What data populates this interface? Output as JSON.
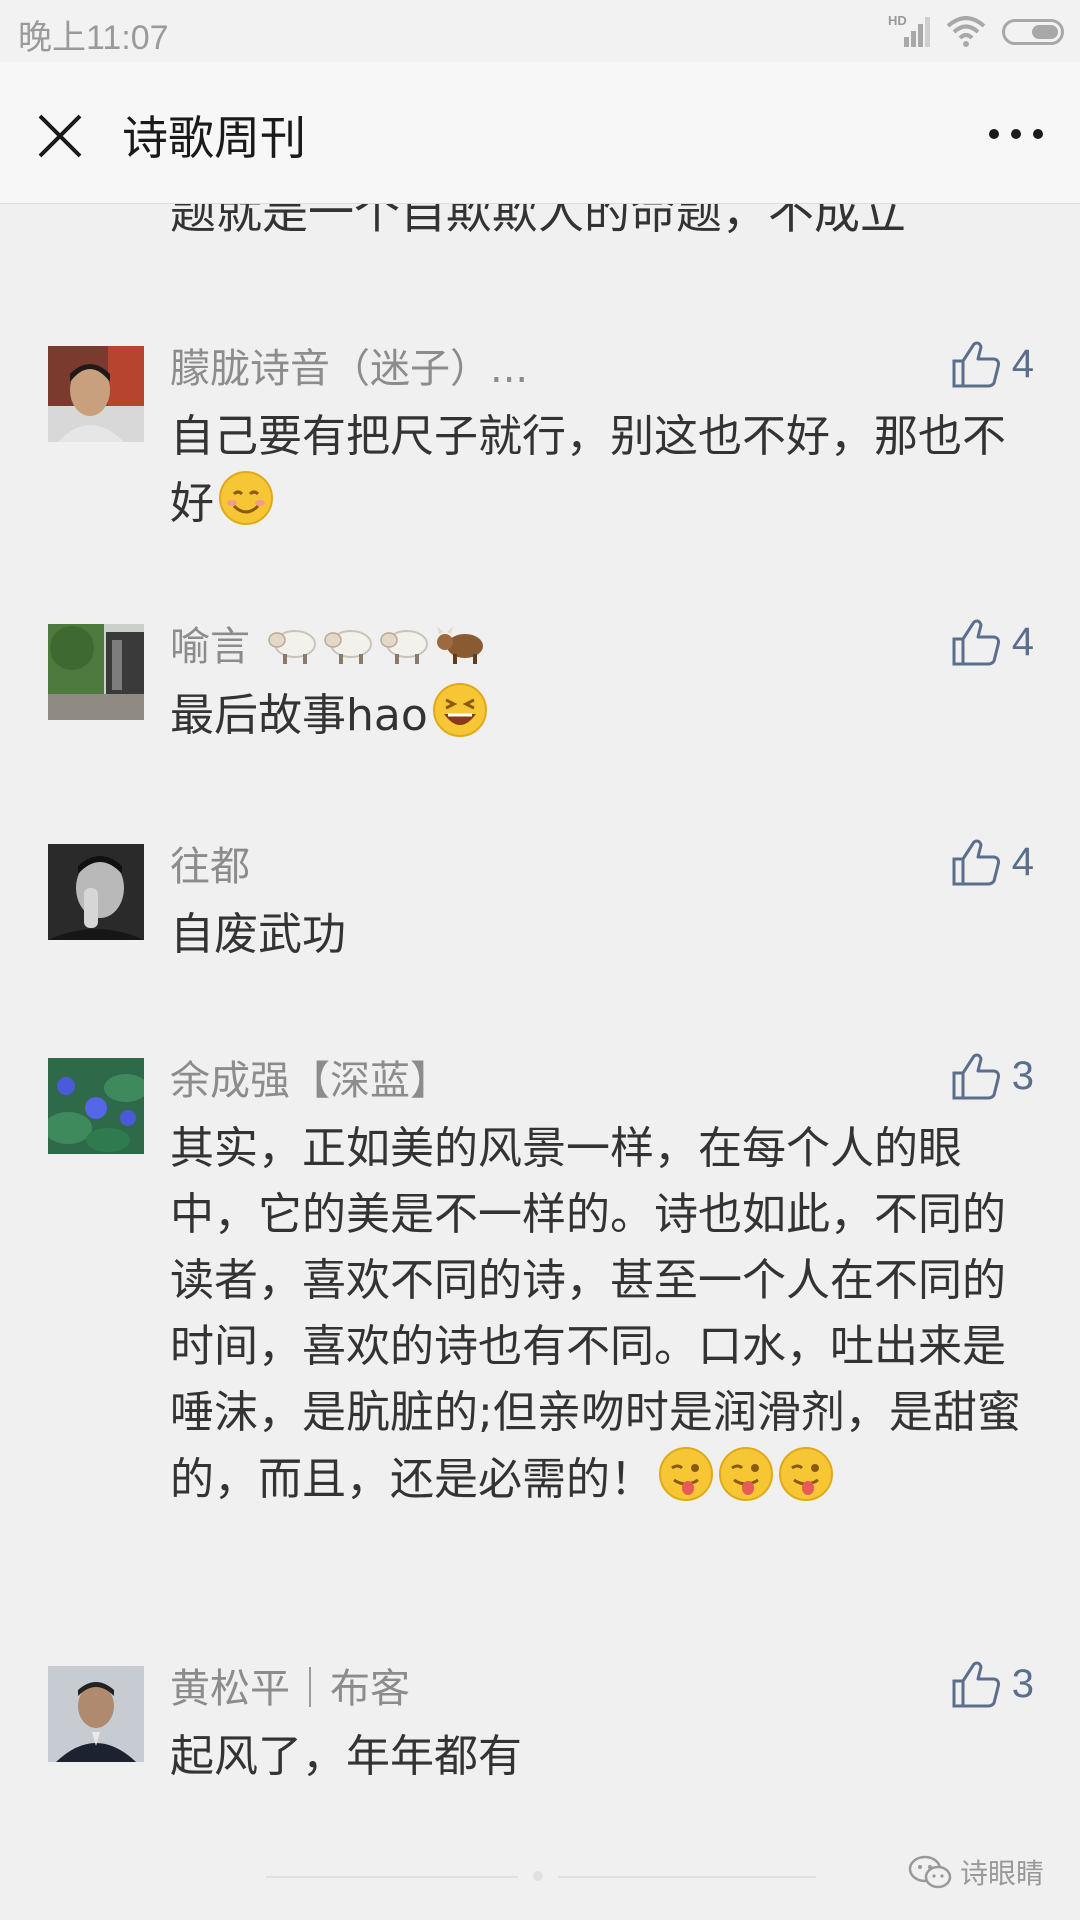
{
  "status_bar": {
    "time": "晚上11:07",
    "hd_label": "HD",
    "icons": [
      "hd-signal-icon",
      "wifi-icon",
      "battery-icon"
    ]
  },
  "header": {
    "title": "诗歌周刊",
    "close_icon": "close-icon",
    "more_icon": "more-icon"
  },
  "partial_comment_text": "题就是一个自欺欺人的命题，不成立",
  "comments": [
    {
      "name": "朦胧诗音（迷子）...",
      "likes": "4",
      "text": "自己要有把尺子就行，别这也不好，那也不好",
      "emojis": [
        "smile-emoji"
      ]
    },
    {
      "name": "喻言",
      "name_emojis": [
        "sheep-emoji",
        "sheep-emoji",
        "sheep-emoji",
        "ox-emoji"
      ],
      "likes": "4",
      "text": "最后故事hao",
      "emojis": [
        "laughing-emoji"
      ]
    },
    {
      "name": "往都",
      "likes": "4",
      "text": "自废武功"
    },
    {
      "name": "余成强【深蓝】",
      "likes": "3",
      "text": "其实，正如美的风景一样，在每个人的眼中，它的美是不一样的。诗也如此，不同的读者，喜欢不同的诗，甚至一个人在不同的时间，喜欢的诗也有不同。口水，吐出来是唾沫，是肮脏的;但亲吻时是润滑剂，是甜蜜的，而且，还是必需的！",
      "emojis": [
        "wink-tongue-emoji",
        "wink-tongue-emoji",
        "wink-tongue-emoji"
      ]
    },
    {
      "name": "黄松平｜布客",
      "likes": "3",
      "text": "起风了，年年都有"
    }
  ],
  "watermark": {
    "text": "诗眼睛",
    "icon": "wechat-icon"
  },
  "colors": {
    "like_blue": "#5a6f8e",
    "name_gray": "#8c8c8c",
    "text": "#333333",
    "background": "#f0f0f0"
  }
}
